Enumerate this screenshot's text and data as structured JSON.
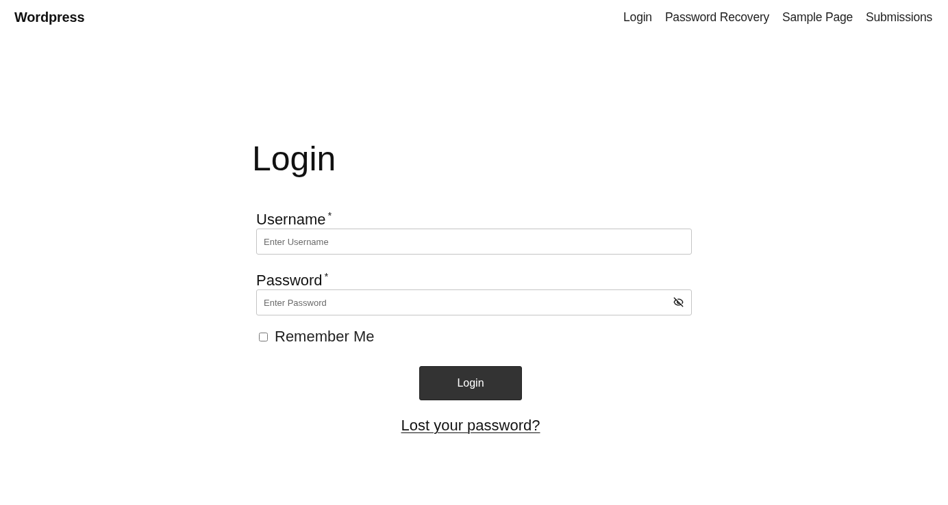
{
  "header": {
    "site_title": "Wordpress",
    "nav": [
      {
        "label": "Login"
      },
      {
        "label": "Password Recovery"
      },
      {
        "label": "Sample Page"
      },
      {
        "label": "Submissions"
      }
    ]
  },
  "form": {
    "title": "Login",
    "fields": [
      {
        "kind": "text",
        "label": "Username$^{*}$",
        "placeholder": "Enter Username"
      },
      {
        "kind": "password",
        "label": "Password$^{*}$",
        "placeholder": "Enter Password"
      }
    ],
    "remember": {
      "label": "Remember Me",
      "checked": false
    },
    "submit": "Login",
    "lost_password_link": "Lost your password?"
  }
}
